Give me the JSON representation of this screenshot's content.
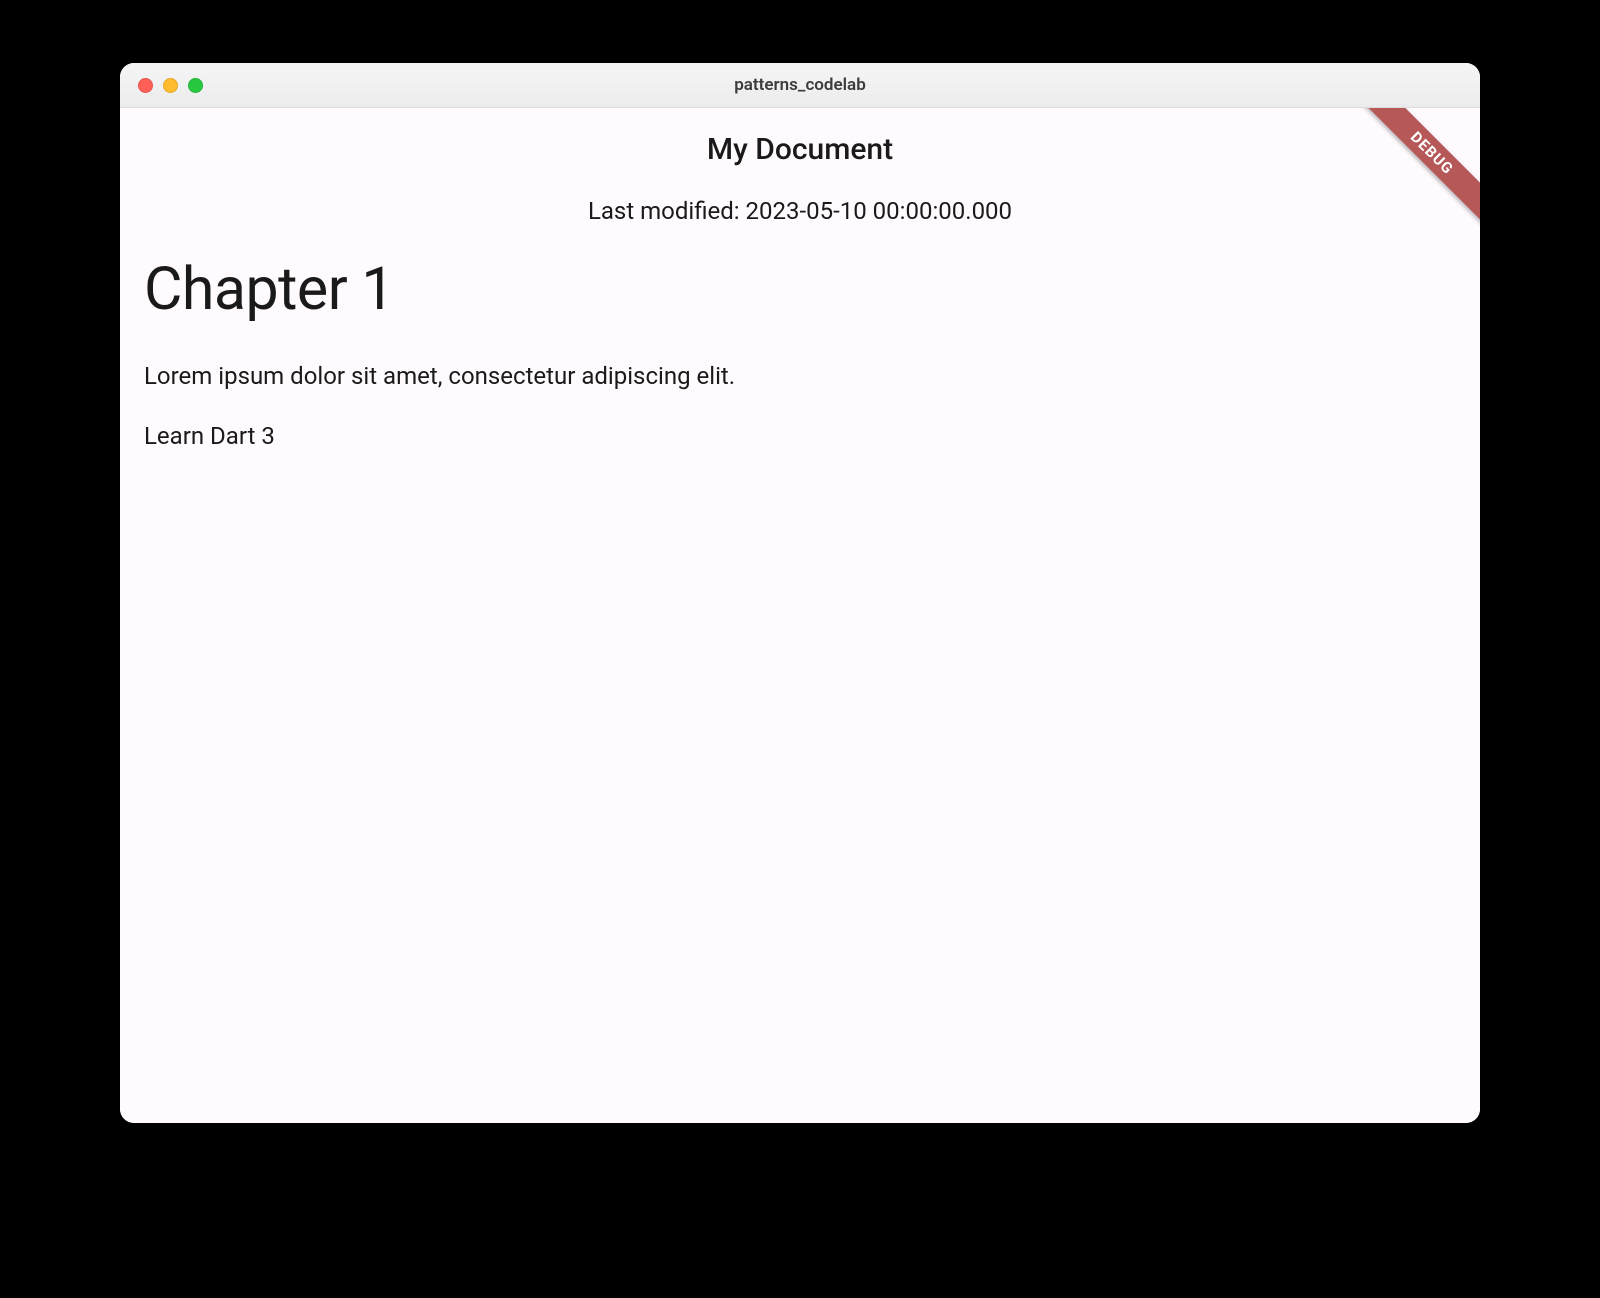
{
  "window": {
    "title": "patterns_codelab"
  },
  "app": {
    "title": "My Document",
    "lastModified": "Last modified: 2023-05-10 00:00:00.000"
  },
  "document": {
    "chapterHeading": "Chapter 1",
    "paragraph": "Lorem ipsum dolor sit amet, consectetur adipiscing elit.",
    "item": "Learn Dart 3"
  },
  "debug": {
    "label": "DEBUG"
  }
}
